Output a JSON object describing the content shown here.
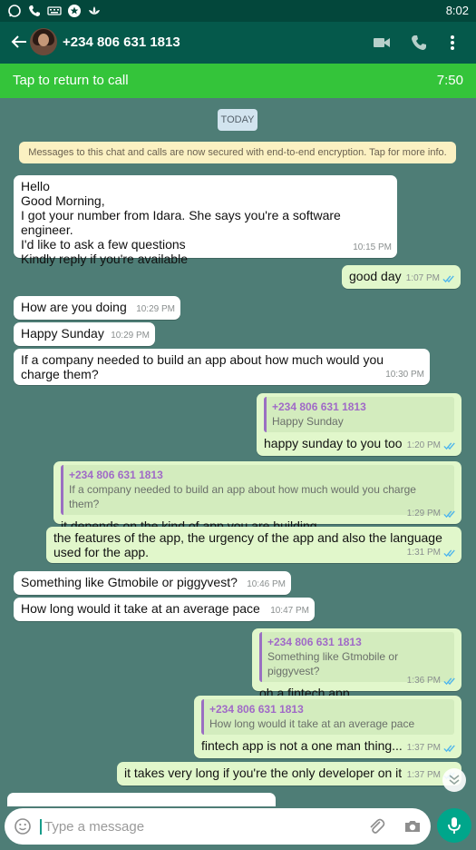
{
  "status_bar": {
    "time": "8:02",
    "icons": [
      "whatsapp-icon",
      "phone-icon",
      "keyboard-icon",
      "star-icon",
      "lotus-icon"
    ]
  },
  "header": {
    "contact": "+234 806 631 1813"
  },
  "call_bar": {
    "label": "Tap to return to call",
    "duration": "7:50"
  },
  "chat": {
    "date_chip": "TODAY",
    "encryption_notice": "Messages to this chat and calls are now secured with end-to-end encryption. Tap for more info.",
    "messages": [
      {
        "dir": "in",
        "lines": [
          "Hello",
          "Good Morning,",
          "I got your number from Idara. She says you're a software engineer.",
          "I'd like to ask a few questions",
          "Kindly reply if you're available"
        ],
        "time": "10:15 PM"
      },
      {
        "dir": "out",
        "text": "good day",
        "time": "1:07 PM"
      },
      {
        "dir": "in",
        "text": "How are you doing",
        "time": "10:29 PM"
      },
      {
        "dir": "in",
        "text": "Happy Sunday",
        "time": "10:29 PM"
      },
      {
        "dir": "in",
        "text": "If a company needed to build an app about how much would you charge them?",
        "time": "10:30 PM"
      },
      {
        "dir": "out",
        "quote_name": "+234 806 631 1813",
        "quote_text": "Happy Sunday",
        "text": "happy sunday to you too",
        "time": "1:20 PM"
      },
      {
        "dir": "out",
        "quote_name": "+234 806 631 1813",
        "quote_text": "If a company needed to build an app about how much would you charge them?",
        "text": "it depends on the kind of app you are building",
        "time": "1:29 PM"
      },
      {
        "dir": "out",
        "text": "the features of the app, the urgency of the app and also the language used for the app.",
        "time": "1:31 PM"
      },
      {
        "dir": "in",
        "text": "Something like Gtmobile or piggyvest?",
        "time": "10:46 PM"
      },
      {
        "dir": "in",
        "text": "How long would it take at an average pace",
        "time": "10:47 PM"
      },
      {
        "dir": "out",
        "quote_name": "+234 806 631 1813",
        "quote_text": "Something like Gtmobile or piggyvest?",
        "text": "oh a fintech app",
        "time": "1:36 PM"
      },
      {
        "dir": "out",
        "quote_name": "+234 806 631 1813",
        "quote_text": "How long would it take at an average pace",
        "text": "fintech app is not a one man thing...",
        "time": "1:37 PM"
      },
      {
        "dir": "out",
        "text": "it takes very long if you're the only developer on it",
        "time": "1:37 PM"
      }
    ]
  },
  "composer": {
    "placeholder": "Type a message"
  },
  "colors": {
    "header": "#05594b",
    "status_bar": "#03473b",
    "call_bar": "#34c43a",
    "chat_bg": "#4e7d76",
    "outgoing_bubble": "#e1f7cb",
    "incoming_bubble": "#ffffff",
    "read_ticks": "#4fb6ec",
    "quote_name": "#a06ac7",
    "mic_button": "#00a68b"
  }
}
